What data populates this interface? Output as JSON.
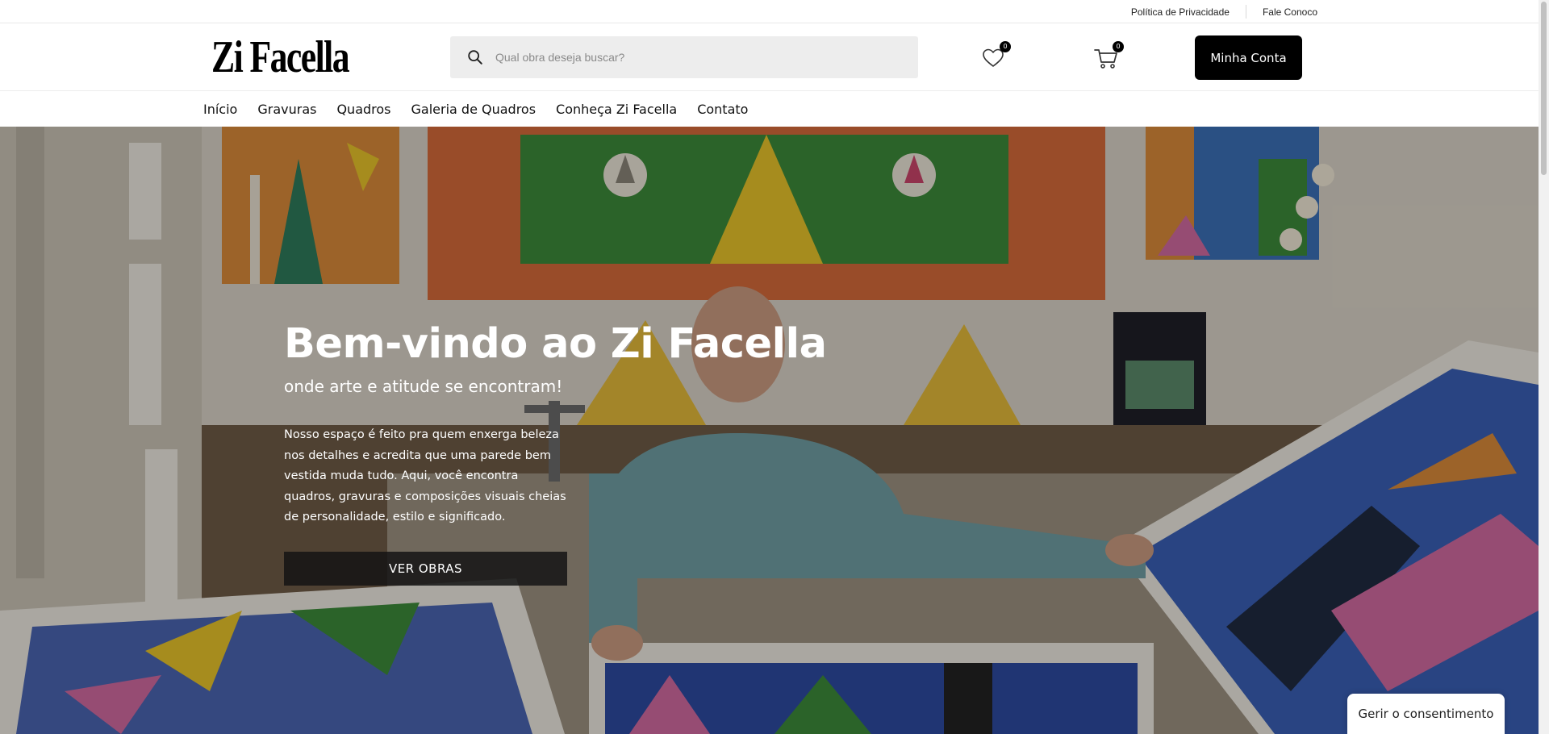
{
  "topbar": {
    "privacy_label": "Política de Privacidade",
    "contact_label": "Fale Conoco"
  },
  "header": {
    "logo_text": "Zi Facella",
    "search_placeholder": "Qual obra deseja buscar?",
    "wishlist_count": "0",
    "cart_count": "0",
    "account_label": "Minha Conta"
  },
  "nav": {
    "items": [
      "Início",
      "Gravuras",
      "Quadros",
      "Galeria de Quadros",
      "Conheça Zi Facella",
      "Contato"
    ]
  },
  "hero": {
    "title": "Bem-vindo ao Zi Facella",
    "subtitle": "onde arte e atitude se encontram!",
    "description": "Nosso espaço é feito pra quem enxerga beleza nos detalhes e acredita que uma parede bem vestida muda tudo. Aqui, você encontra quadros, gravuras e composições visuais cheias de personalidade, estilo e significado.",
    "button_label": "VER OBRAS"
  },
  "consent": {
    "label": "Gerir o consentimento"
  },
  "icons": {
    "search": "search-icon",
    "wishlist": "heart-icon",
    "cart": "cart-icon"
  },
  "colors": {
    "accent": "#000000",
    "search_bg": "#ededed"
  }
}
